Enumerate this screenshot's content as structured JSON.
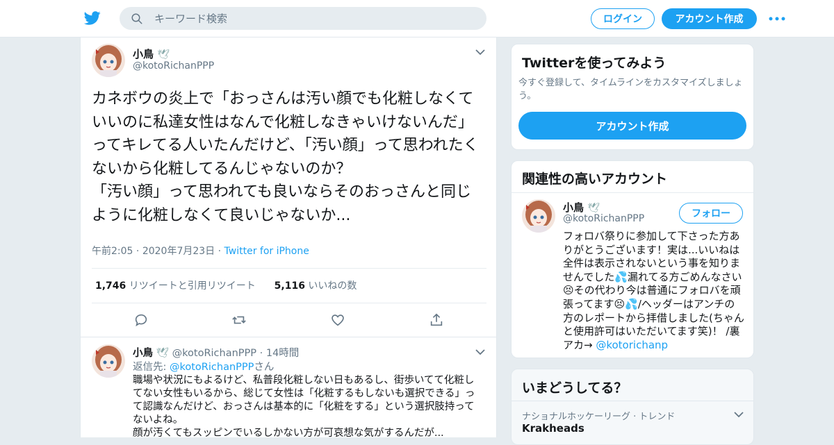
{
  "header": {
    "search_placeholder": "キーワード検索",
    "login_label": "ログイン",
    "signup_label": "アカウント作成",
    "icons": {
      "logo": "twitter-bird-icon",
      "search": "search-icon",
      "more": "more-dots-icon"
    }
  },
  "tweet": {
    "name": "小鳥",
    "name_emoji": "🕊",
    "handle": "@kotoRichanPPP",
    "text": "カネボウの炎上で「おっさんは汚い顔でも化粧しなくていいのに私達女性はなんで化粧しなきゃいけないんだ」ってキレてる人いたんだけど、「汚い顔」って思われたくないから化粧してるんじゃないのか？\n「汚い顔」って思われても良いならそのおっさんと同じように化粧しなくて良いじゃないか...",
    "time": "午前2:05",
    "date": "2020年7月23日",
    "source": "Twitter for iPhone",
    "retweets_count": "1,746",
    "retweets_label": "リツイートと引用リツイート",
    "likes_count": "5,116",
    "likes_label": "いいねの数",
    "actions": [
      "reply-icon",
      "retweet-icon",
      "like-icon",
      "share-icon"
    ]
  },
  "reply": {
    "name": "小鳥",
    "handle": "@kotoRichanPPP",
    "time": "14時間",
    "replying_to_label": "返信先:",
    "replying_to_handle": "@kotoRichanPPP",
    "replying_to_suffix": "さん",
    "text": "職場や状況にもよるけど、私普段化粧しない日もあるし、街歩いてて化粧してない女性もいるから、総じて女性は「化粧するもしないも選択できる」って認識なんだけど、おっさんは基本的に「化粧をする」という選択肢持ってないよね。\n顔が汚くてもスッピンでいるしかない方が可哀想な気がするんだが..."
  },
  "sidebar": {
    "signup_card": {
      "title": "Twitterを使ってみよう",
      "subtitle": "今すぐ登録して、タイムラインをカスタマイズしましょう。",
      "button": "アカウント作成"
    },
    "related_card": {
      "title": "関連性の高いアカウント",
      "name": "小鳥",
      "handle": "@kotoRichanPPP",
      "follow_label": "フォロー",
      "bio": "フォロバ祭りに参加して下さった方ありがとうございます！実は...いいねは全件は表示されないという事を知りませんでした💦漏れてる方ごめんなさい😣その代わり今は普通にフォロバを頑張ってます😣💦/ヘッダーはアンチの方のレポートから拝借しました(ちゃんと使用許可はいただいてます笑)！ /裏アカ→ ",
      "bio_link": "@kotorichanp"
    },
    "trends_card": {
      "title": "いまどうしてる？",
      "category": "ナショナルホッケーリーグ · トレンド",
      "trend": "Krakheads"
    }
  },
  "colors": {
    "accent": "#1da1f2",
    "background": "#e6ecf0",
    "text": "#14171a",
    "muted": "#657786"
  }
}
